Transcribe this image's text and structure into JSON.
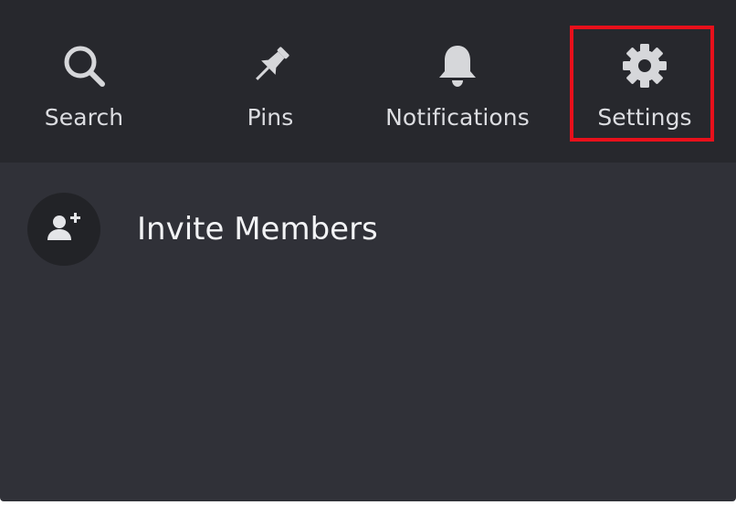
{
  "toolbar": {
    "search_label": "Search",
    "pins_label": "Pins",
    "notifications_label": "Notifications",
    "settings_label": "Settings"
  },
  "menu": {
    "invite_label": "Invite Members"
  },
  "colors": {
    "panel_bg": "#303138",
    "toolbar_bg": "#27282d",
    "icon_color": "#d6d7da",
    "highlight": "#e8101b"
  },
  "icons": {
    "search": "search-icon",
    "pins": "pin-icon",
    "notifications": "bell-icon",
    "settings": "gear-icon",
    "invite": "add-user-icon"
  }
}
